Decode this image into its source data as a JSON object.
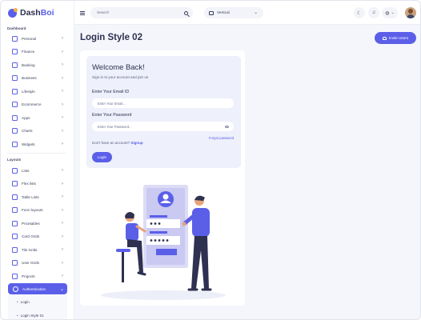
{
  "brand": {
    "name_main": "Dash",
    "name_accent": "Boi"
  },
  "sidebar": {
    "section_dashboard": "Dashboard",
    "dashboard_items": [
      {
        "label": "Personal",
        "icon": "user-icon"
      },
      {
        "label": "Finance",
        "icon": "finance-icon"
      },
      {
        "label": "Banking",
        "icon": "bank-icon"
      },
      {
        "label": "Business",
        "icon": "briefcase-icon"
      },
      {
        "label": "Lifestyle",
        "icon": "lifestyle-icon"
      },
      {
        "label": "Ecommerce",
        "icon": "cart-icon"
      },
      {
        "label": "Apps",
        "icon": "apps-icon"
      },
      {
        "label": "Charts",
        "icon": "chart-icon"
      },
      {
        "label": "Widgets",
        "icon": "widget-icon"
      }
    ],
    "section_layouts": "Layouts",
    "layout_items": [
      {
        "label": "Lists",
        "icon": "list-icon"
      },
      {
        "label": "Flex lists",
        "icon": "flex-list-icon"
      },
      {
        "label": "Table Lists",
        "icon": "table-icon"
      },
      {
        "label": "Form layouts",
        "icon": "form-icon"
      },
      {
        "label": "Pricetables",
        "icon": "price-icon"
      },
      {
        "label": "Card Grids",
        "icon": "card-grid-icon"
      },
      {
        "label": "Tile Grids",
        "icon": "tile-grid-icon"
      },
      {
        "label": "User Grids",
        "icon": "user-grid-icon"
      },
      {
        "label": "Projects",
        "icon": "project-icon"
      }
    ],
    "active_item": {
      "label": "Authentication",
      "icon": "lock-icon"
    },
    "submenu": [
      "Login",
      "Login Style 01"
    ]
  },
  "header": {
    "search_placeholder": "Search",
    "layout_select": "Vertical",
    "icons": [
      "menu-icon",
      "search-icon",
      "layout-icon",
      "moon-icon",
      "bell-icon",
      "globe-icon"
    ]
  },
  "main": {
    "page_title": "Login Style 02",
    "invite_button": "Invite Users"
  },
  "login": {
    "title": "Welcome Back!",
    "subtitle": "Sign in to your account and join us",
    "email_label": "Enter Your Email ID",
    "email_placeholder": "Enter Your Email...",
    "password_label": "Enter Your Password",
    "password_placeholder": "Enter Your Password...",
    "forgot": "Forgot password",
    "no_account": "Don't have an account?",
    "signup": "Signup",
    "login_button": "Login"
  },
  "colors": {
    "accent": "#5b5fe8",
    "background": "#f5f6fb",
    "panel": "#eef0fb"
  }
}
